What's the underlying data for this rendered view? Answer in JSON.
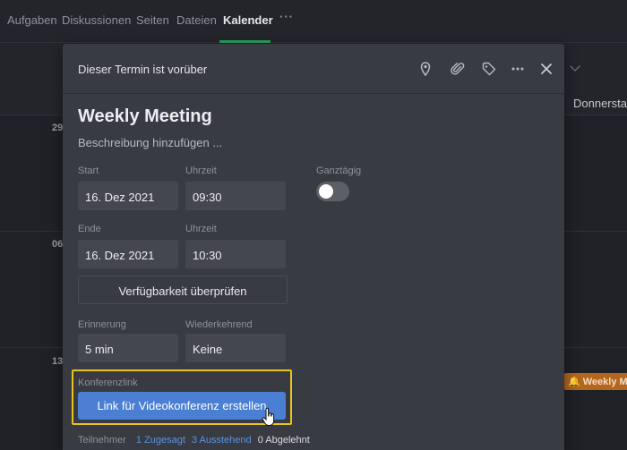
{
  "nav": {
    "tabs": [
      {
        "label": "Aufgaben",
        "active": false
      },
      {
        "label": "Diskussionen",
        "active": false
      },
      {
        "label": "Seiten",
        "active": false
      },
      {
        "label": "Dateien",
        "active": false
      },
      {
        "label": "Kalender",
        "active": true
      }
    ],
    "more_icon": "more-horizontal-icon",
    "accent_color": "#2aa061"
  },
  "calendar": {
    "day_name": "Donnerstag",
    "dates": [
      "29",
      "06",
      "13"
    ],
    "event_chip": {
      "label": "🔔 Weekly Meeting",
      "color": "#b5651d"
    }
  },
  "modal": {
    "status": "Dieser Termin ist vorüber",
    "header_icons": [
      "location-pin-icon",
      "paperclip-icon",
      "tag-icon",
      "more-horizontal-icon",
      "close-icon"
    ],
    "title": "Weekly Meeting",
    "description_placeholder": "Beschreibung hinzufügen ...",
    "start": {
      "label": "Start",
      "date": "16. Dez 2021",
      "time_label": "Uhrzeit",
      "time": "09:30"
    },
    "end": {
      "label": "Ende",
      "date": "16. Dez 2021",
      "time_label": "Uhrzeit",
      "time": "10:30"
    },
    "all_day": {
      "label": "Ganztägig",
      "on": false
    },
    "availability_button": "Verfügbarkeit überprüfen",
    "reminder": {
      "label": "Erinnerung",
      "value": "5 min"
    },
    "recurring": {
      "label": "Wiederkehrend",
      "value": "Keine"
    },
    "conference": {
      "label": "Konferenzlink",
      "button": "Link für Videokonferenz erstellen",
      "button_color": "#4a7fd4",
      "highlight_color": "#e8c41a"
    },
    "participants": {
      "label": "Teilnehmer",
      "accepted": "1 Zugesagt",
      "pending": "3 Ausstehend",
      "declined": "0 Abgelehnt"
    }
  }
}
